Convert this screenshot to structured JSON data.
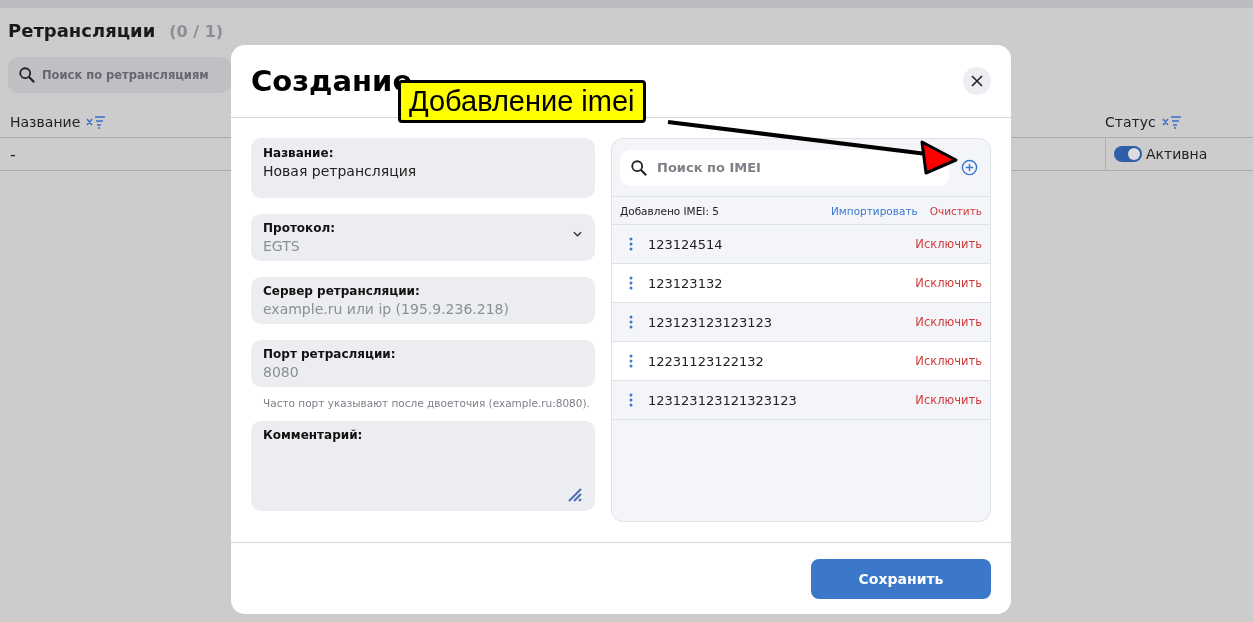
{
  "page": {
    "title": "Ретрансляции",
    "count": "(0 / 1)",
    "search": {
      "placeholder": "Поиск по ретрансляциям"
    },
    "table": {
      "columns": [
        {
          "label": "Название"
        },
        {
          "label": "Статус"
        }
      ],
      "rows": [
        {
          "name": "-",
          "status": {
            "on": true,
            "label": "Активна"
          }
        }
      ]
    }
  },
  "dialog": {
    "title": "Создание",
    "fields": [
      {
        "kind": "input",
        "label": "Название:",
        "value": "Новая ретрансляция"
      },
      {
        "kind": "select",
        "label": "Протокол:",
        "placeholder": "EGTS"
      },
      {
        "kind": "input",
        "label": "Сервер ретрансляции:",
        "placeholder": "example.ru или ip (195.9.236.218)"
      },
      {
        "kind": "input",
        "label": "Порт ретрасляции:",
        "placeholder": "8080",
        "hint": "Часто порт указывают после двоеточия (example.ru:8080)."
      },
      {
        "kind": "textarea",
        "label": "Комментарий:"
      }
    ],
    "imei": {
      "search": {
        "placeholder": "Поиск по IMEI"
      },
      "count": "Добавлено IMEI: 5",
      "import": "Импортировать",
      "clear": "Очистить",
      "items": [
        {
          "value": "123124514",
          "action": "Исключить"
        },
        {
          "value": "123123132",
          "action": "Исключить"
        },
        {
          "value": "123123123123123",
          "action": "Исключить"
        },
        {
          "value": "12231123122132",
          "action": "Исключить"
        },
        {
          "value": "123123123121323123",
          "action": "Исключить"
        }
      ]
    },
    "save": "Сохранить"
  },
  "annotation": {
    "label": "Добавление imei"
  }
}
